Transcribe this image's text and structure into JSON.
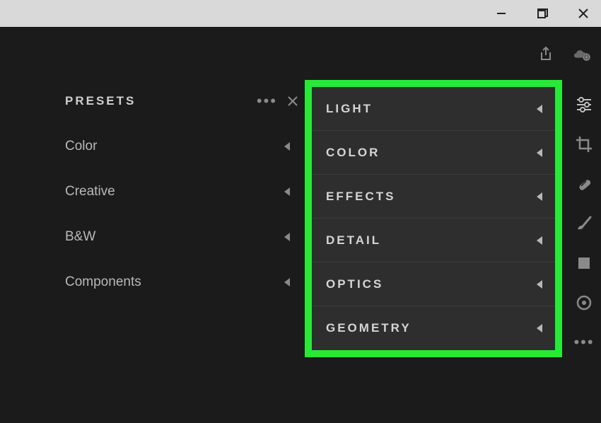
{
  "titlebar": {
    "minimize": "–",
    "maximize": "▢",
    "close": "✕"
  },
  "toprow": {
    "share": "share-icon",
    "cloud": "cloud-icon"
  },
  "presets": {
    "header": "PRESETS",
    "items": [
      {
        "label": "Color"
      },
      {
        "label": "Creative"
      },
      {
        "label": "B&W"
      },
      {
        "label": "Components"
      }
    ]
  },
  "edit_panels": [
    {
      "label": "LIGHT"
    },
    {
      "label": "COLOR"
    },
    {
      "label": "EFFECTS"
    },
    {
      "label": "DETAIL"
    },
    {
      "label": "OPTICS"
    },
    {
      "label": "GEOMETRY"
    }
  ],
  "tools": [
    "sliders-icon",
    "crop-icon",
    "heal-icon",
    "brush-icon",
    "square-icon",
    "radial-icon",
    "more-icon"
  ]
}
